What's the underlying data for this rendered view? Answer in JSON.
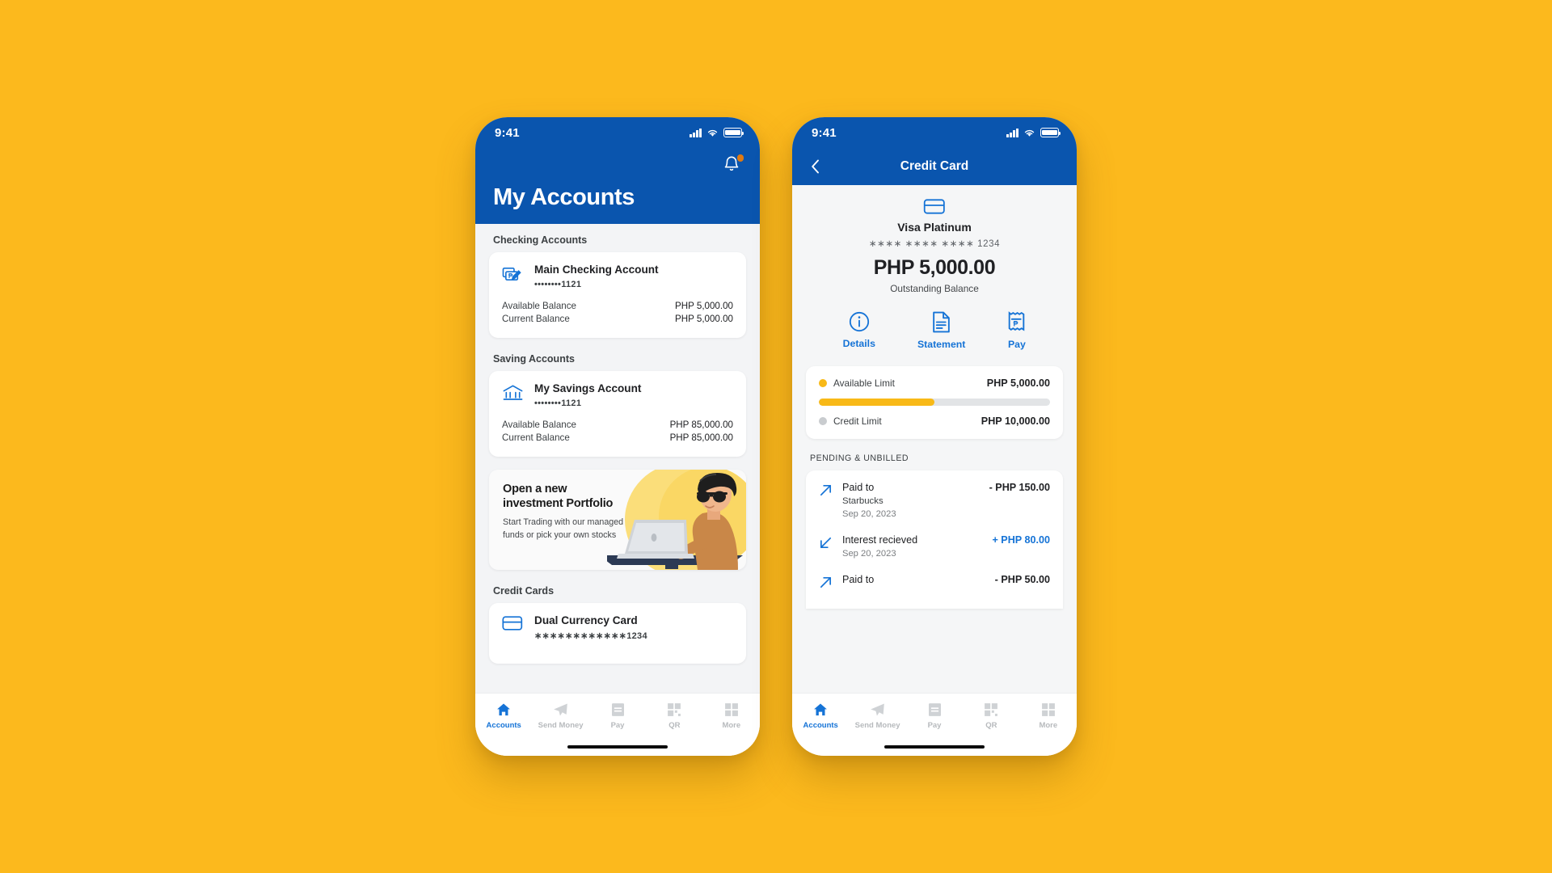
{
  "theme": {
    "background": "#FCB91D",
    "brand_blue": "#0A55AE",
    "accent_blue": "#1573D6",
    "accent_yellow": "#F8B917",
    "badge_orange": "#E07A12"
  },
  "status_bar": {
    "time": "9:41",
    "signal_icon": "cellular-signal-icon",
    "wifi_icon": "wifi-icon",
    "battery_icon": "battery-icon"
  },
  "accounts_screen": {
    "title": "My Accounts",
    "bell_icon": "notification-bell-icon",
    "sections": [
      {
        "label": "Checking Accounts",
        "accounts": [
          {
            "icon": "cheque-edit-icon",
            "name": "Main Checking Account",
            "number": "••••••••1121",
            "rows": [
              {
                "label": "Available Balance",
                "value": "PHP 5,000.00"
              },
              {
                "label": "Current Balance",
                "value": "PHP 5,000.00"
              }
            ]
          }
        ]
      },
      {
        "label": "Saving Accounts",
        "accounts": [
          {
            "icon": "bank-building-icon",
            "name": "My Savings Account",
            "number": "••••••••1121",
            "rows": [
              {
                "label": "Available Balance",
                "value": "PHP 85,000.00"
              },
              {
                "label": "Current Balance",
                "value": "PHP 85,000.00"
              }
            ]
          }
        ]
      },
      {
        "label": "Credit Cards",
        "accounts": [
          {
            "icon": "credit-card-icon",
            "name": "Dual Currency Card",
            "number": "∗∗∗∗∗∗∗∗∗∗∗∗1234",
            "rows": []
          }
        ]
      }
    ],
    "promo": {
      "heading": "Open a new investment Portfolio",
      "body": "Start Trading with our managed funds or pick your own stocks",
      "art": "person-at-laptop-illustration"
    }
  },
  "credit_card_screen": {
    "header_title": "Credit Card",
    "back_icon": "back-chevron-icon",
    "card": {
      "icon": "credit-card-icon",
      "name": "Visa Platinum",
      "masked_number": "∗∗∗∗ ∗∗∗∗ ∗∗∗∗ 1234",
      "amount": "PHP 5,000.00",
      "amount_label": "Outstanding Balance"
    },
    "actions": [
      {
        "label": "Details",
        "icon": "info-circle-icon"
      },
      {
        "label": "Statement",
        "icon": "document-icon"
      },
      {
        "label": "Pay",
        "icon": "receipt-peso-icon"
      }
    ],
    "limits": {
      "available": {
        "label": "Available Limit",
        "value": "PHP 5,000.00",
        "dot_color": "#F8B917"
      },
      "credit": {
        "label": "Credit Limit",
        "value": "PHP 10,000.00",
        "dot_color": "#C9CCCF"
      },
      "progress_percent": 50
    },
    "transactions_label": "PENDING & UNBILLED",
    "transactions": [
      {
        "icon": "arrow-out-icon",
        "title": "Paid to",
        "merchant": "Starbucks",
        "date": "Sep 20, 2023",
        "amount": "- PHP 150.00",
        "direction": "debit"
      },
      {
        "icon": "arrow-in-icon",
        "title": "Interest recieved",
        "merchant": "",
        "date": "Sep 20, 2023",
        "amount": "+ PHP 80.00",
        "direction": "credit"
      },
      {
        "icon": "arrow-out-icon",
        "title": "Paid to",
        "merchant": "",
        "date": "",
        "amount": "- PHP 50.00",
        "direction": "debit"
      }
    ]
  },
  "tabbar": {
    "items": [
      {
        "label": "Accounts",
        "icon": "home-icon",
        "active": true
      },
      {
        "label": "Send Money",
        "icon": "paper-plane-icon",
        "active": false
      },
      {
        "label": "Pay",
        "icon": "bill-peso-icon",
        "active": false
      },
      {
        "label": "QR",
        "icon": "qr-code-icon",
        "active": false
      },
      {
        "label": "More",
        "icon": "grid-icon",
        "active": false
      }
    ]
  }
}
